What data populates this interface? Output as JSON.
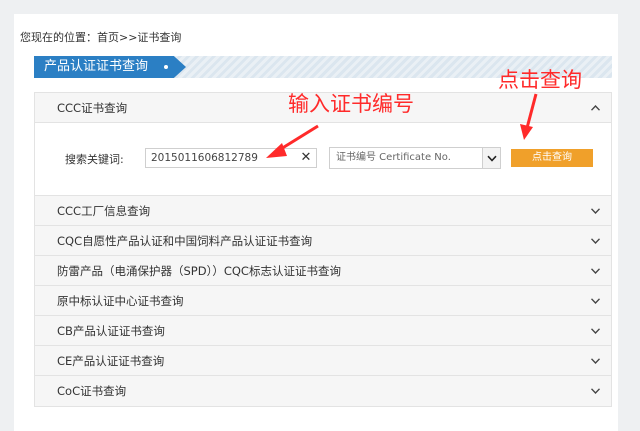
{
  "breadcrumb": "您现在的位置：首页>>证书查询",
  "section_title": "产品认证证书查询",
  "panels": [
    {
      "label": "CCC证书查询",
      "expanded": true
    },
    {
      "label": "CCC工厂信息查询"
    },
    {
      "label": "CQC自愿性产品认证和中国饲料产品认证证书查询"
    },
    {
      "label": "防雷产品（电涌保护器（SPD））CQC标志认证证书查询"
    },
    {
      "label": "原中标认证中心证书查询"
    },
    {
      "label": "CB产品认证证书查询"
    },
    {
      "label": "CE产品认证证书查询"
    },
    {
      "label": "CoC证书查询"
    }
  ],
  "search": {
    "label": "搜索关键词:",
    "value": "2015011606812789",
    "select_value": "证书编号 Certificate No.",
    "button": "点击查询"
  },
  "annotations": {
    "input_hint": "输入证书编号",
    "click_hint": "点击查询"
  },
  "colors": {
    "accent_blue": "#2b7fc4",
    "button_orange": "#f0a02a",
    "annotation_red": "#ff2a2a"
  }
}
